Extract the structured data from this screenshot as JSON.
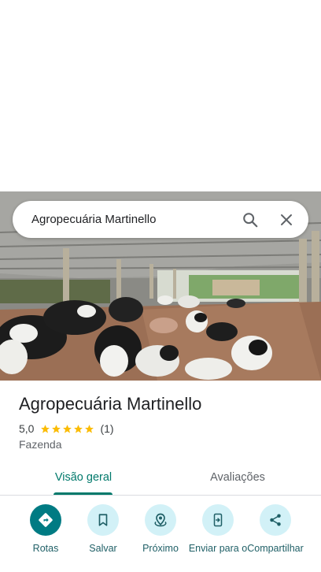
{
  "search": {
    "query": "Agropecuária Martinello"
  },
  "place": {
    "title": "Agropecuária Martinello",
    "rating": "5,0",
    "review_count": "(1)",
    "stars": 5,
    "category": "Fazenda"
  },
  "tabs": [
    {
      "label": "Visão geral",
      "active": true
    },
    {
      "label": "Avaliações",
      "active": false
    }
  ],
  "actions": [
    {
      "label": "Rotas",
      "icon": "directions-icon"
    },
    {
      "label": "Salvar",
      "icon": "bookmark-icon"
    },
    {
      "label": "Próximo",
      "icon": "nearby-icon"
    },
    {
      "label": "Enviar para o",
      "icon": "send-to-phone-icon"
    },
    {
      "label": "Compartilhar",
      "icon": "share-icon"
    }
  ],
  "colors": {
    "accent": "#00796b",
    "action_bg": "#d2f1f7",
    "primary_action": "#007b83",
    "star": "#fbbc04"
  }
}
